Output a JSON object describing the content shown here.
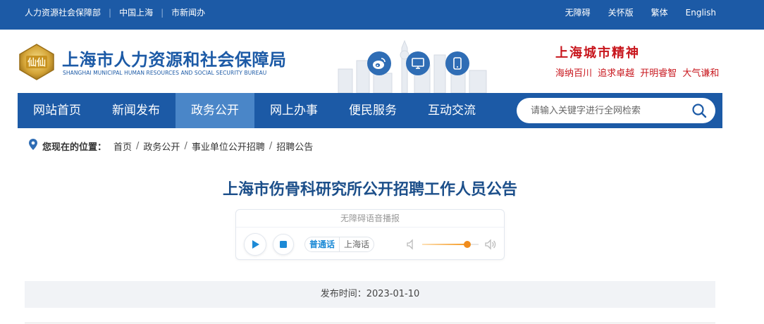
{
  "topbar": {
    "left_links": [
      "人力资源社会保障部",
      "中国上海",
      "市新闻办"
    ],
    "right_links": [
      "无障碍",
      "关怀版",
      "繁体",
      "English"
    ]
  },
  "header": {
    "site_name_cn": "上海市人力资源和社会保障局",
    "site_name_en": "SHANGHAI MUNICIPAL HUMAN RESOURCES AND SOCIAL SECURITY BUREAU",
    "emblem_text": "仙仙",
    "social_icons": [
      "weibo-icon",
      "desktop-icon",
      "mobile-icon"
    ],
    "city_spirit_title": "上海城市精神",
    "city_spirit_motto": "海纳百川 追求卓越 开明睿智 大气谦和"
  },
  "nav": {
    "items": [
      "网站首页",
      "新闻发布",
      "政务公开",
      "网上办事",
      "便民服务",
      "互动交流"
    ],
    "active": "政务公开",
    "search_placeholder": "请输入关键字进行全网检索"
  },
  "breadcrumb": {
    "label": "您现在的位置：",
    "items": [
      "首页",
      "政务公开",
      "事业单位公开招聘",
      "招聘公告"
    ]
  },
  "article": {
    "title": "上海市伤骨科研究所公开招聘工作人员公告",
    "publish_label": "发布时间：",
    "publish_date": "2023-01-10"
  },
  "player": {
    "title": "无障碍语音播报",
    "dialects": [
      "普通话",
      "上海话"
    ],
    "selected_dialect": "普通话",
    "volume": 0.8
  },
  "colors": {
    "brand_blue": "#1c5aa6",
    "nav_active": "#4a86c8",
    "spirit_red": "#c8161d",
    "title_blue": "#1c4f8a",
    "slider_orange": "#f08c1c"
  }
}
